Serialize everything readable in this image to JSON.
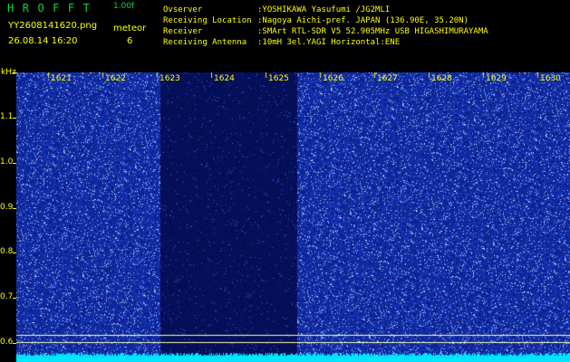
{
  "header": {
    "logo": "HROFFT",
    "version": "1.00f",
    "filename": "YY2608141620.png",
    "meteor_label": "meteor",
    "datetime": "26.08.14 16:20",
    "meteor_count": "6",
    "info": [
      {
        "label": "Ovserver",
        "value": ":YOSHIKAWA Yasufumi /JG2MLI"
      },
      {
        "label": "Receiving Location",
        "value": ":Nagoya Aichi-pref. JAPAN (136.90E, 35.20N)"
      },
      {
        "label": "Receiver",
        "value": ":SMArt RTL-SDR V5 52.905MHz USB HIGASHIMURAYAMA"
      },
      {
        "label": "Receiving Antenna",
        "value": ":10mH 3el.YAGI Horizontal:ENE"
      }
    ]
  },
  "axis": {
    "unit": "kHz",
    "x_ticks": [
      "1621",
      "1622",
      "1623",
      "1624",
      "1625",
      "1626",
      "1627",
      "1628",
      "1629",
      "1630"
    ],
    "y_ticks": [
      "1.1",
      "1.0",
      "0.9",
      "0.8",
      "0.7",
      "0.6"
    ]
  },
  "colors": {
    "background": "#000000",
    "waterfall_base": "#0b1a9a",
    "trace": "#00e5ff",
    "text": "#ffff00",
    "logo": "#1ecf3a"
  }
}
